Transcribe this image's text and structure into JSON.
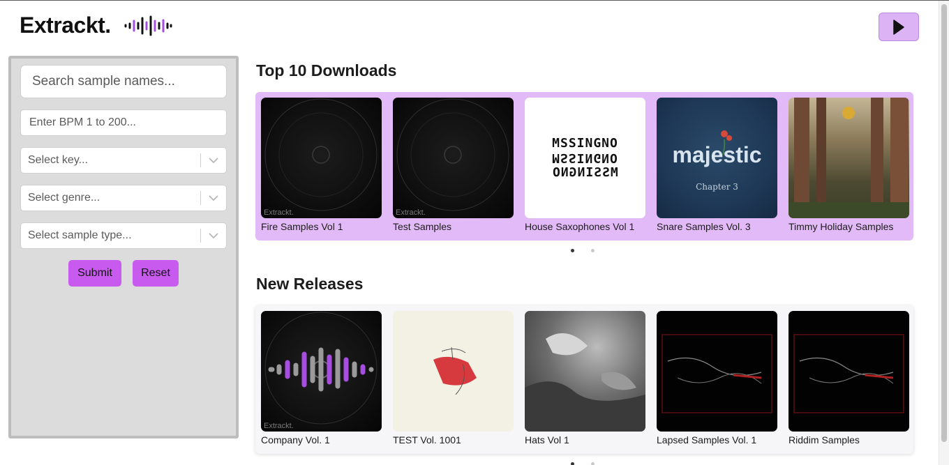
{
  "header": {
    "logo_text": "Extrackt.",
    "play_icon": "play-icon"
  },
  "sidebar": {
    "search_placeholder": "Search sample names...",
    "bpm_placeholder": "Enter BPM 1 to 200...",
    "key_placeholder": "Select key...",
    "genre_placeholder": "Select genre...",
    "type_placeholder": "Select sample type...",
    "submit_label": "Submit",
    "reset_label": "Reset"
  },
  "top_downloads": {
    "title": "Top 10 Downloads",
    "items": [
      {
        "name": "Fire Samples Vol 1",
        "watermark": "Extrackt."
      },
      {
        "name": "Test Samples",
        "watermark": "Extrackt."
      },
      {
        "name": "House Saxophones Vol 1",
        "art_text": "MSSINGNO"
      },
      {
        "name": "Snare Samples Vol. 3",
        "art_text": "majestic",
        "art_sub": "Chapter 3"
      },
      {
        "name": "Timmy Holiday Samples"
      }
    ]
  },
  "new_releases": {
    "title": "New Releases",
    "items": [
      {
        "name": "Company Vol. 1",
        "watermark": "Extrackt."
      },
      {
        "name": "TEST Vol. 1001"
      },
      {
        "name": "Hats Vol 1"
      },
      {
        "name": "Lapsed Samples Vol. 1"
      },
      {
        "name": "Riddim Samples"
      }
    ]
  },
  "colors": {
    "accent": "#c85af0",
    "accent_light": "#e2baf7",
    "sidebar_bg": "#dcdcdc"
  }
}
